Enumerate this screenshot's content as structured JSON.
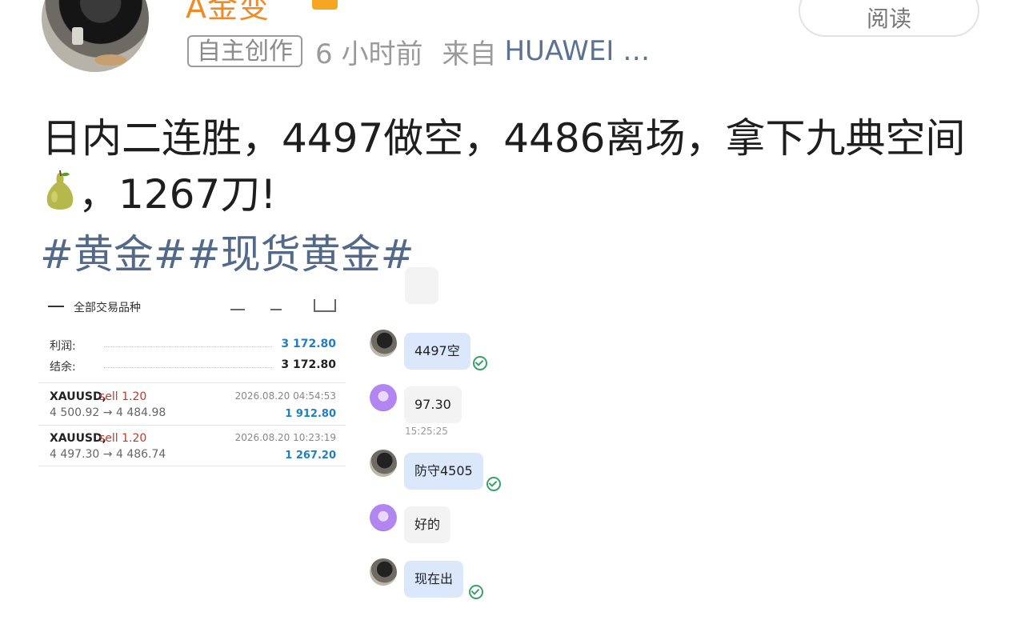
{
  "post": {
    "username": "A金变",
    "read_label": "阅读",
    "tag": "自主创作",
    "time": "6 小时前",
    "source_prefix": "来自",
    "source_device": "HUAWEI …",
    "text_part1": "日内二连胜，4497做空，4486离场，拿下九典空间",
    "text_part2": "，1267刀!",
    "hashtags": "#黄金##现货黄金#"
  },
  "trade_screenshot": {
    "header": "全部交易品种",
    "profit_label": "利润:",
    "profit_value": "3 172.80",
    "balance_label": "结余:",
    "balance_value": "3 172.80",
    "deals": [
      {
        "symbol": "XAUUSD,",
        "side": "sell 1.20",
        "datetime": "2026.08.20 04:54:53",
        "prices": "4 500.92 → 4 484.98",
        "profit": "1 912.80"
      },
      {
        "symbol": "XAUUSD,",
        "side": "sell 1.20",
        "datetime": "2026.08.20 10:23:19",
        "prices": "4 497.30 → 4 486.74",
        "profit": "1 267.20"
      }
    ]
  },
  "chat": {
    "messages": [
      {
        "text": "4497空"
      },
      {
        "text": "97.30",
        "time": "15:25:25"
      },
      {
        "text": "防守4505"
      },
      {
        "text": "好的"
      },
      {
        "text": "现在出"
      }
    ]
  },
  "colors": {
    "username": "#f08a24",
    "hashtag": "#52698a",
    "profit_blue": "#1f7fc1",
    "sell_red": "#c0392b",
    "my_bubble": "#dbe8fb"
  }
}
